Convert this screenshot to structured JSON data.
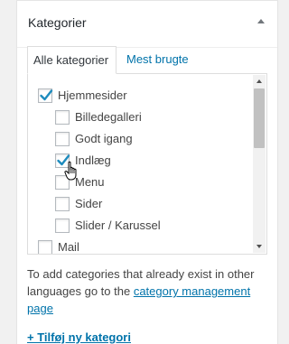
{
  "metabox": {
    "title": "Kategorier",
    "toggle_icon": "triangle-up-icon"
  },
  "tabs": [
    {
      "label": "Alle kategorier",
      "active": true
    },
    {
      "label": "Mest brugte",
      "active": false
    }
  ],
  "categories": [
    {
      "label": "Hjemmesider",
      "checked": true,
      "level": 0
    },
    {
      "label": "Billedegalleri",
      "checked": false,
      "level": 1
    },
    {
      "label": "Godt igang",
      "checked": false,
      "level": 1
    },
    {
      "label": "Indlæg",
      "checked": true,
      "level": 1
    },
    {
      "label": "Menu",
      "checked": false,
      "level": 1
    },
    {
      "label": "Sider",
      "checked": false,
      "level": 1
    },
    {
      "label": "Slider / Karussel",
      "checked": false,
      "level": 1
    },
    {
      "label": "Mail",
      "checked": false,
      "level": 0
    }
  ],
  "note": {
    "text": "To add categories that already exist in other languages go to the ",
    "link": "category management page"
  },
  "add_new": "+ Tilføj ny kategori",
  "colors": {
    "link": "#0073aa",
    "check": "#1e8cbe",
    "border": "#dddddd"
  }
}
